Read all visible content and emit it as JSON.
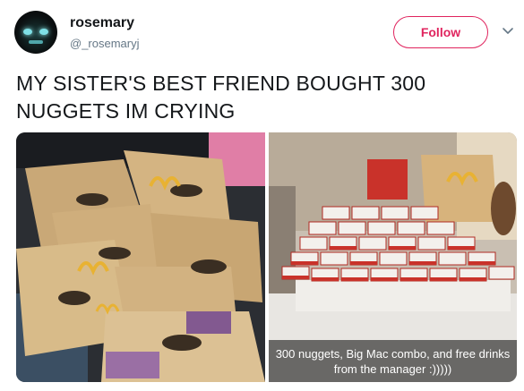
{
  "user": {
    "display_name": "rosemary",
    "handle": "@_rosemaryj",
    "avatar_icon": "avatar-image"
  },
  "follow_button": {
    "label": "Follow",
    "color": "#e0245e"
  },
  "menu": {
    "icon": "chevron-down-icon"
  },
  "tweet": {
    "text": "MY SISTER'S BEST FRIEND BOUGHT 300 NUGGETS IM CRYING"
  },
  "media": {
    "photos": [
      {
        "name": "photo-bags-in-car",
        "description_icon": "photo"
      },
      {
        "name": "photo-nugget-boxes-on-table",
        "description_icon": "photo"
      }
    ],
    "caption": "300 nuggets, Big Mac combo, and free drinks from the manager :)))))"
  },
  "colors": {
    "text": "#14171a",
    "secondary_text": "#657786",
    "accent": "#e0245e"
  }
}
